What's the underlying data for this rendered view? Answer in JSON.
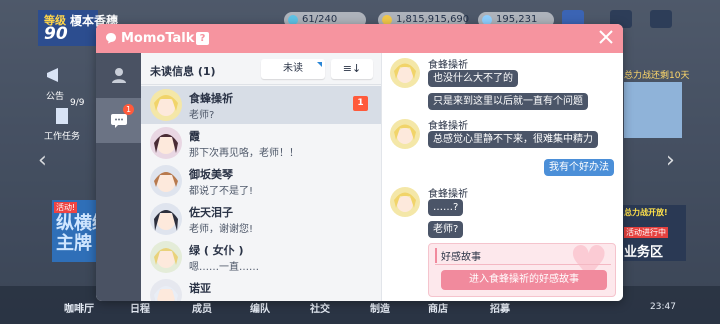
{
  "background": {
    "level_label": "等级",
    "level_value": "90",
    "player_name": "榎本香穗",
    "stamina": "61/240",
    "credits": "1,815,915,690",
    "gems": "195,231",
    "left_hud": [
      "公告",
      "工作任务"
    ],
    "hud_counter": "9/9",
    "event_banner": {
      "tag": "活动!",
      "text": "纵横编\n主牌"
    },
    "right_banner_title": "总力战还剩10天",
    "right_promo": {
      "line1": "总力战开放!",
      "line2": "活动进行中",
      "line3": "业务区"
    },
    "bottom_nav": [
      "咖啡厅",
      "日程",
      "成员",
      "编队",
      "社交",
      "制造",
      "商店",
      "招募"
    ],
    "time": "23:47"
  },
  "momotalk": {
    "title": "MomoTalk",
    "help": "?",
    "side_badge": "1",
    "list": {
      "title": "未读信息 (1)",
      "sort_value": "未读",
      "order_icon": "≡↓",
      "conversations": [
        {
          "name": "食蜂操祈",
          "preview": "老师?",
          "unread": "1",
          "selected": true
        },
        {
          "name": "霞",
          "preview": "那下次再见咯，老师！！"
        },
        {
          "name": "御坂美琴",
          "preview": "都说了不是了!"
        },
        {
          "name": "佐天泪子",
          "preview": "老师，谢谢您!"
        },
        {
          "name": "绿 ( 女仆 )",
          "preview": "嗯……一直……"
        },
        {
          "name": "诺亚",
          "preview": ""
        }
      ]
    },
    "chat": {
      "sender": "食蜂操祈",
      "msgs_1": [
        "也没什么大不了的",
        "只是来到这里以后就一直有个问题"
      ],
      "msgs_2": [
        "总感觉心里静不下来，很难集中精力"
      ],
      "reply": "我有个好办法",
      "msgs_3": [
        "……?",
        "老师?"
      ],
      "fav_title": "好感故事",
      "fav_button": "进入食蜂操祈的好感故事"
    }
  },
  "colors": {
    "header_pink": "#f6949f",
    "sidebar": "#4a5263",
    "bubble_gray": "#4b5568",
    "bubble_blue": "#4b8fd8",
    "badge_red": "#ff5a3b"
  }
}
